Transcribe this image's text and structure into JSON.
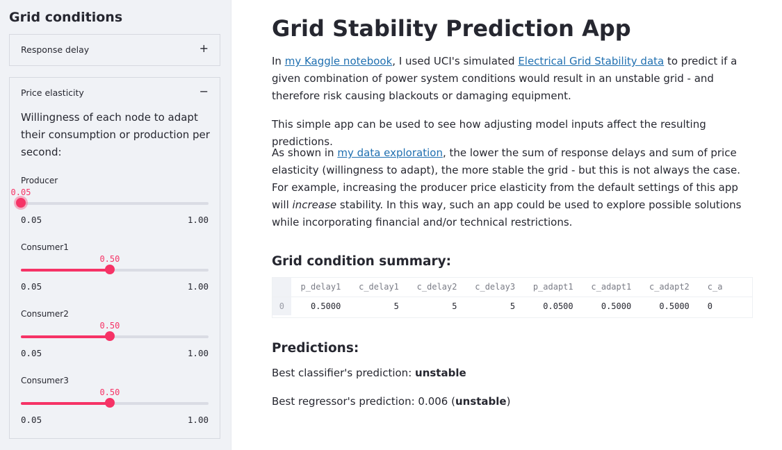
{
  "sidebar": {
    "title": "Grid conditions",
    "response_delay": {
      "label": "Response delay",
      "toggle": "+"
    },
    "price_elasticity": {
      "label": "Price elasticity",
      "toggle": "−",
      "description": "Willingness of each node to adapt their consumption or production per second:",
      "sliders": [
        {
          "label": "Producer",
          "value": "0.05",
          "min": "0.05",
          "max": "1.00",
          "fraction": 0.0
        },
        {
          "label": "Consumer1",
          "value": "0.50",
          "min": "0.05",
          "max": "1.00",
          "fraction": 0.4737
        },
        {
          "label": "Consumer2",
          "value": "0.50",
          "min": "0.05",
          "max": "1.00",
          "fraction": 0.4737
        },
        {
          "label": "Consumer3",
          "value": "0.50",
          "min": "0.05",
          "max": "1.00",
          "fraction": 0.4737
        }
      ]
    }
  },
  "main": {
    "title": "Grid Stability Prediction App",
    "intro": {
      "t1": "In ",
      "link1": "my Kaggle notebook",
      "t2": ", I used UCI's simulated ",
      "link2": "Electrical Grid Stability data",
      "t3": " to predict if a given combination of power system conditions would result in an unstable grid - and therefore risk causing blackouts or damaging equipment."
    },
    "simple": "This simple app can be used to see how adjusting model inputs affect the resulting predictions.",
    "explore": {
      "t1": "As shown in ",
      "link": "my data exploration",
      "t2": ", the lower the sum of response delays and sum of price elasticity (willingness to adapt), the more stable the grid - but this is not always the case. For example, increasing the producer price elasticity from the default settings of this app will ",
      "em": "increase",
      "t3": " stability. In this way, such an app could be used to explore possible solutions while incorporating financial and/or technical restrictions."
    },
    "summary_heading": "Grid condition summary:",
    "table": {
      "columns": [
        "p_delay1",
        "c_delay1",
        "c_delay2",
        "c_delay3",
        "p_adapt1",
        "c_adapt1",
        "c_adapt2",
        "c_a"
      ],
      "rows": [
        {
          "index": "0",
          "cells": [
            "0.5000",
            "5",
            "5",
            "5",
            "0.0500",
            "0.5000",
            "0.5000",
            "0"
          ]
        }
      ]
    },
    "predictions_heading": "Predictions:",
    "classifier": {
      "prefix": "Best classifier's prediction: ",
      "value": "unstable"
    },
    "regressor": {
      "prefix": "Best regressor's prediction: 0.006 (",
      "value": "unstable",
      "suffix": ")"
    }
  },
  "colors": {
    "accent": "#f63366",
    "link": "#1f6fb0",
    "sidebar_bg": "#f0f2f6"
  }
}
